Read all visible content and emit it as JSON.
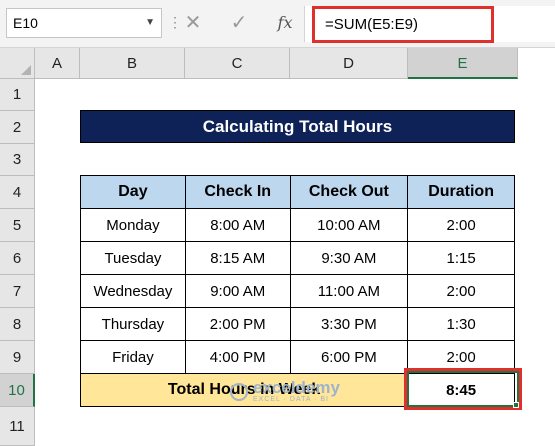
{
  "formula_bar": {
    "name_box": "E10",
    "cancel_glyph": "✕",
    "enter_glyph": "✓",
    "fx_label": "fx",
    "formula": "=SUM(E5:E9)"
  },
  "columns": [
    "A",
    "B",
    "C",
    "D",
    "E"
  ],
  "rows": [
    "1",
    "2",
    "3",
    "4",
    "5",
    "6",
    "7",
    "8",
    "9",
    "10",
    "11"
  ],
  "selected_cell": "E10",
  "sheet": {
    "title": "Calculating Total Hours",
    "headers": [
      "Day",
      "Check In",
      "Check Out",
      "Duration"
    ],
    "records": [
      [
        "Monday",
        "8:00 AM",
        "10:00 AM",
        "2:00"
      ],
      [
        "Tuesday",
        "8:15 AM",
        "9:30 AM",
        "1:15"
      ],
      [
        "Wednesday",
        "9:00 AM",
        "11:00 AM",
        "2:00"
      ],
      [
        "Thursday",
        "2:00 PM",
        "3:30 PM",
        "1:30"
      ],
      [
        "Friday",
        "4:00 PM",
        "6:00 PM",
        "2:00"
      ]
    ],
    "total_label": "Total Hours in Week",
    "total_value": "8:45"
  },
  "watermark": {
    "brand": "exceldemy",
    "tagline": "EXCEL · DATA · BI"
  },
  "colors": {
    "title_bg": "#0e2258",
    "header_bg": "#bdd7ee",
    "total_bg": "#ffe699",
    "highlight": "#e0302c",
    "selection": "#217346"
  }
}
